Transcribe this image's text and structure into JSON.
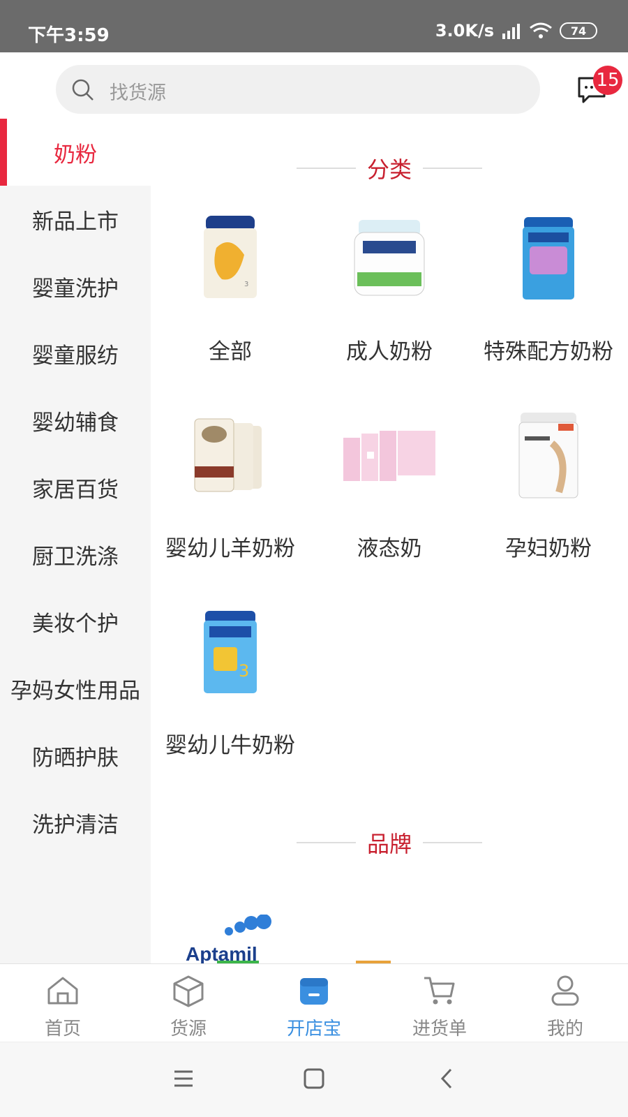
{
  "status_bar": {
    "time": "下午3:59",
    "network_speed": "3.0K/s",
    "battery": "74"
  },
  "header": {
    "search_placeholder": "找货源",
    "message_badge": "15"
  },
  "sidebar": {
    "items": [
      {
        "label": "奶粉",
        "active": true
      },
      {
        "label": "新品上市"
      },
      {
        "label": "婴童洗护"
      },
      {
        "label": "婴童服纺"
      },
      {
        "label": "婴幼辅食"
      },
      {
        "label": "家居百货"
      },
      {
        "label": "厨卫洗涤"
      },
      {
        "label": "美妆个护"
      },
      {
        "label": "孕妈女性用品"
      },
      {
        "label": "防晒护肤"
      },
      {
        "label": "洗护清洁"
      }
    ]
  },
  "main": {
    "category_title": "分类",
    "categories": [
      {
        "label": "全部",
        "icon": "formula-can-gold-icon"
      },
      {
        "label": "成人奶粉",
        "icon": "full-cream-jar-icon"
      },
      {
        "label": "特殊配方奶粉",
        "icon": "aptamil-can-icon"
      },
      {
        "label": "婴幼儿羊奶粉",
        "icon": "goat-milk-cans-icon"
      },
      {
        "label": "液态奶",
        "icon": "milk-cartons-icon"
      },
      {
        "label": "孕妇奶粉",
        "icon": "maternal-formula-can-icon"
      },
      {
        "label": "婴幼儿牛奶粉",
        "icon": "aptamil-stage3-can-icon"
      }
    ],
    "brand_title": "品牌",
    "brand_partial": "Aptamil"
  },
  "tabbar": {
    "tabs": [
      {
        "label": "首页",
        "icon": "home-icon"
      },
      {
        "label": "货源",
        "icon": "box-icon"
      },
      {
        "label": "开店宝",
        "icon": "store-icon",
        "active": true
      },
      {
        "label": "进货单",
        "icon": "cart-icon"
      },
      {
        "label": "我的",
        "icon": "user-icon"
      }
    ]
  },
  "colors": {
    "accent": "#e8283f",
    "title_red": "#c8202f",
    "tab_active": "#3a8fe0"
  }
}
